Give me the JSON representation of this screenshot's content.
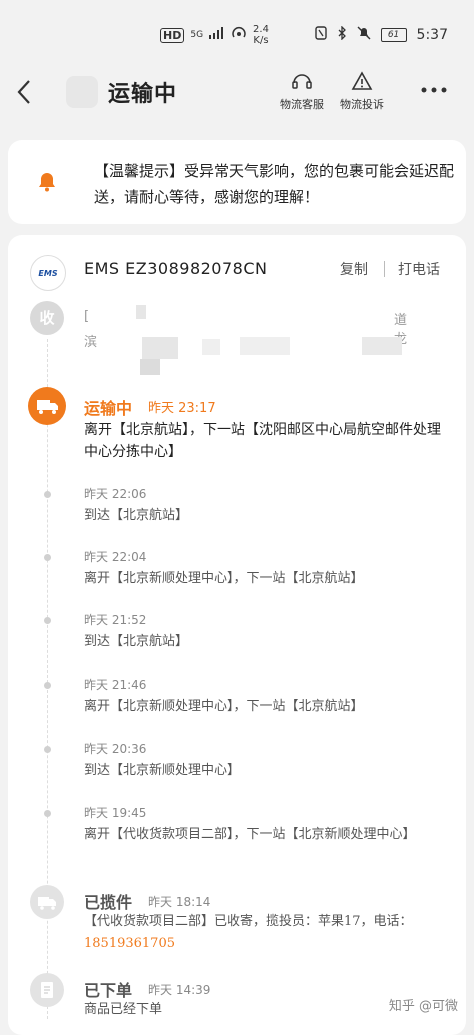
{
  "status_bar": {
    "hd": "HD",
    "network": "5G",
    "speed_value": "2.4",
    "speed_unit": "K/s",
    "battery": "61",
    "time": "5:37"
  },
  "header": {
    "title": "运输中",
    "service_label": "物流客服",
    "complaint_label": "物流投诉"
  },
  "notice": {
    "text": "【温馨提示】受异常天气影响，您的包裹可能会延迟配送，请耐心等待，感谢您的理解！"
  },
  "shipment": {
    "courier_logo": "EMS",
    "tracking": "EMS EZ308982078CN",
    "copy_label": "复制",
    "call_label": "打电话"
  },
  "receiver": {
    "icon_label": "收",
    "line1_start": "[",
    "line1_end": "道 龙",
    "line2_start": "滨"
  },
  "current": {
    "status": "运输中",
    "time": "昨天 23:17",
    "desc": "离开【北京航站】，下一站【沈阳邮区中心局航空邮件处理中心分拣中心】"
  },
  "events": [
    {
      "time": "昨天 22:06",
      "desc": "到达【北京航站】"
    },
    {
      "time": "昨天 22:04",
      "desc": "离开【北京新顺处理中心】，下一站【北京航站】"
    },
    {
      "time": "昨天 21:52",
      "desc": "到达【北京航站】"
    },
    {
      "time": "昨天 21:46",
      "desc": "离开【北京新顺处理中心】，下一站【北京航站】"
    },
    {
      "time": "昨天 20:36",
      "desc": "到达【北京新顺处理中心】"
    },
    {
      "time": "昨天 19:45",
      "desc": "离开【代收货款项目二部】，下一站【北京新顺处理中心】"
    }
  ],
  "picked": {
    "status": "已揽件",
    "time": "昨天 18:14",
    "desc": "【代收货款项目二部】已收寄，揽投员：苹果17，电话：",
    "phone": "18519361705"
  },
  "ordered": {
    "status": "已下单",
    "time": "昨天 14:39",
    "desc": "商品已经下单"
  },
  "watermark": "知乎 @可微"
}
